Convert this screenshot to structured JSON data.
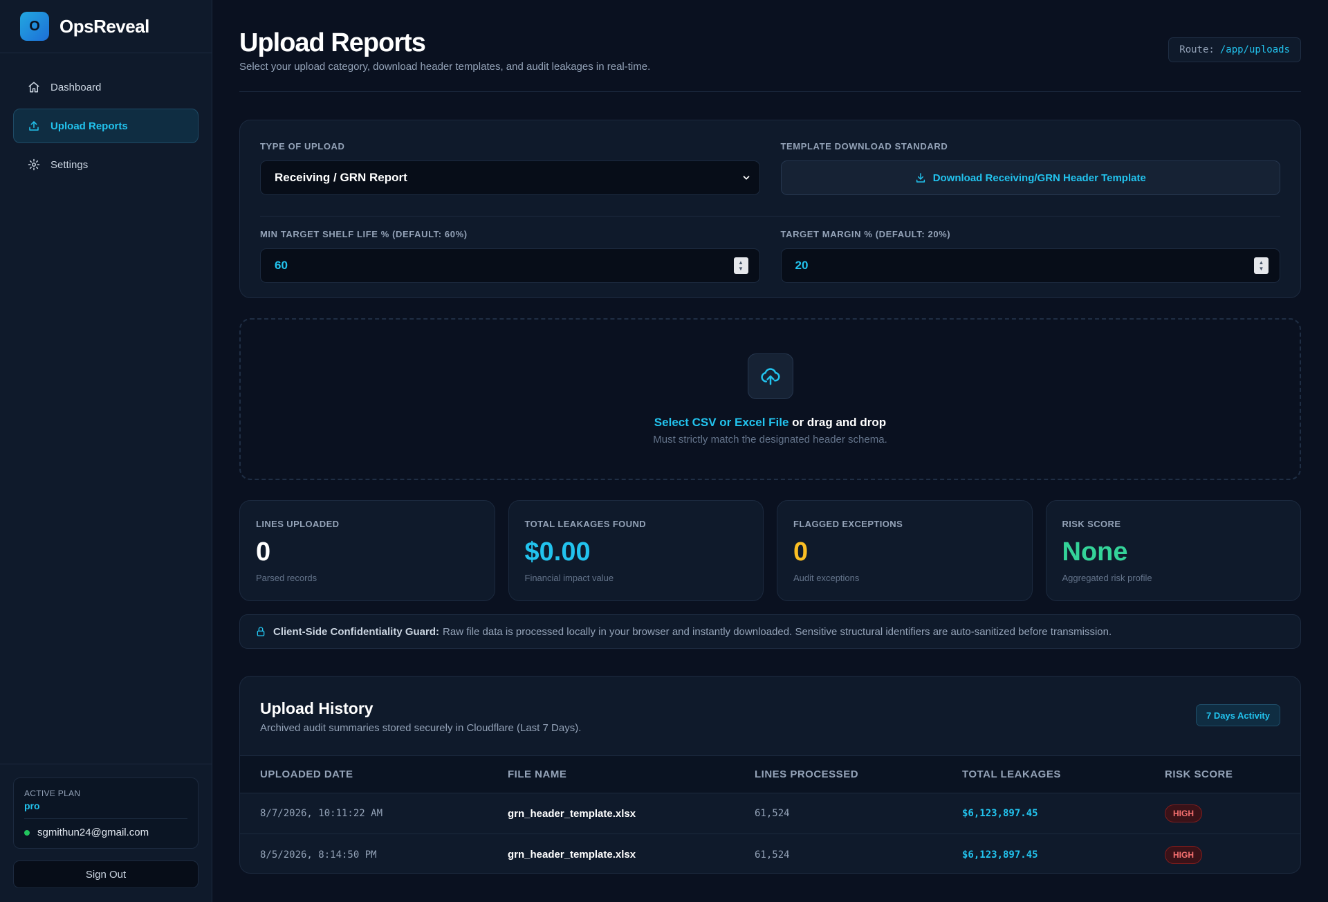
{
  "brand": {
    "logo_letter": "O",
    "name": "OpsReveal"
  },
  "nav": {
    "items": [
      {
        "label": "Dashboard",
        "icon": "home-icon"
      },
      {
        "label": "Upload Reports",
        "icon": "upload-icon",
        "active": true
      },
      {
        "label": "Settings",
        "icon": "gear-icon"
      }
    ]
  },
  "account": {
    "plan_label": "ACTIVE PLAN",
    "plan_name": "pro",
    "email": "sgmithun24@gmail.com",
    "signout_label": "Sign Out"
  },
  "header": {
    "title": "Upload Reports",
    "subtitle": "Select your upload category, download header templates, and audit leakages in real-time.",
    "route_label": "Route:",
    "route_path": "/app/uploads"
  },
  "config": {
    "upload_type_label": "TYPE OF UPLOAD",
    "upload_type_value": "Receiving / GRN Report",
    "template_label": "TEMPLATE DOWNLOAD STANDARD",
    "template_button": "Download Receiving/GRN Header Template",
    "shelf_life_label": "MIN TARGET SHELF LIFE % (DEFAULT: 60%)",
    "shelf_life_value": "60",
    "margin_label": "TARGET MARGIN % (DEFAULT: 20%)",
    "margin_value": "20"
  },
  "dropzone": {
    "link_text": "Select CSV or Excel File",
    "rest_text": " or drag and drop",
    "hint": "Must strictly match the designated header schema."
  },
  "stats": [
    {
      "label": "LINES UPLOADED",
      "value": "0",
      "sub": "Parsed records",
      "color": "#ffffff"
    },
    {
      "label": "TOTAL LEAKAGES FOUND",
      "value": "$0.00",
      "sub": "Financial impact value",
      "color": "#22c3ee"
    },
    {
      "label": "FLAGGED EXCEPTIONS",
      "value": "0",
      "sub": "Audit exceptions",
      "color": "#fbbf24"
    },
    {
      "label": "RISK SCORE",
      "value": "None",
      "sub": "Aggregated risk profile",
      "color": "#34d399"
    }
  ],
  "guard": {
    "title": "Client-Side Confidentiality Guard:",
    "text": "Raw file data is processed locally in your browser and instantly downloaded. Sensitive structural identifiers are auto-sanitized before transmission."
  },
  "history": {
    "title": "Upload History",
    "subtitle": "Archived audit summaries stored securely in Cloudflare (Last 7 Days).",
    "badge": "7 Days Activity",
    "columns": [
      "UPLOADED DATE",
      "FILE NAME",
      "LINES PROCESSED",
      "TOTAL LEAKAGES",
      "RISK SCORE"
    ],
    "rows": [
      {
        "date": "8/7/2026, 10:11:22 AM",
        "file": "grn_header_template.xlsx",
        "lines": "61,524",
        "leakages": "$6,123,897.45",
        "risk": "HIGH"
      },
      {
        "date": "8/5/2026, 8:14:50 PM",
        "file": "grn_header_template.xlsx",
        "lines": "61,524",
        "leakages": "$6,123,897.45",
        "risk": "HIGH"
      }
    ]
  },
  "colors": {
    "accent": "#22c3ee",
    "background": "#0a1120",
    "sidebar": "#0f1a2b",
    "danger": "#f87171",
    "success": "#22c55e"
  }
}
